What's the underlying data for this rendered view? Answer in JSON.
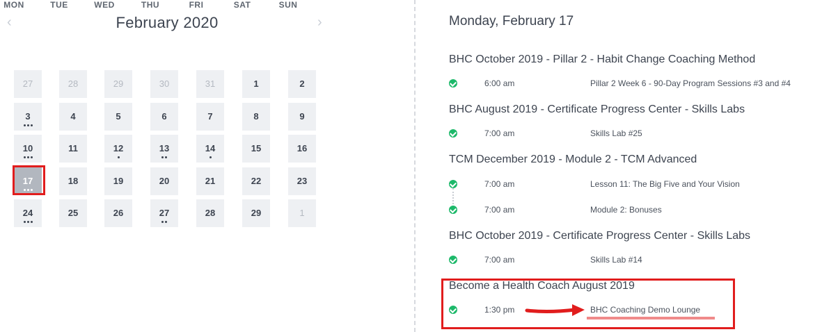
{
  "calendar": {
    "month_title": "February 2020",
    "prev_icon": "chevron-left-icon",
    "next_icon": "chevron-right-icon",
    "prev_glyph": "‹",
    "next_glyph": "›",
    "weekdays": [
      "MON",
      "TUE",
      "WED",
      "THU",
      "FRI",
      "SAT",
      "SUN"
    ],
    "weeks": [
      [
        {
          "d": "27",
          "other": true,
          "dots": 0
        },
        {
          "d": "28",
          "other": true,
          "dots": 0
        },
        {
          "d": "29",
          "other": true,
          "dots": 0
        },
        {
          "d": "30",
          "other": true,
          "dots": 0
        },
        {
          "d": "31",
          "other": true,
          "dots": 0
        },
        {
          "d": "1",
          "dots": 0
        },
        {
          "d": "2",
          "dots": 0
        }
      ],
      [
        {
          "d": "3",
          "dots": 3
        },
        {
          "d": "4",
          "dots": 0
        },
        {
          "d": "5",
          "dots": 0
        },
        {
          "d": "6",
          "dots": 0
        },
        {
          "d": "7",
          "dots": 0
        },
        {
          "d": "8",
          "dots": 0
        },
        {
          "d": "9",
          "dots": 0
        }
      ],
      [
        {
          "d": "10",
          "dots": 3
        },
        {
          "d": "11",
          "dots": 0
        },
        {
          "d": "12",
          "dots": 1
        },
        {
          "d": "13",
          "dots": 2
        },
        {
          "d": "14",
          "dots": 1
        },
        {
          "d": "15",
          "dots": 0
        },
        {
          "d": "16",
          "dots": 0
        }
      ],
      [
        {
          "d": "17",
          "dots": 3,
          "selected": true
        },
        {
          "d": "18",
          "dots": 0
        },
        {
          "d": "19",
          "dots": 0
        },
        {
          "d": "20",
          "dots": 0
        },
        {
          "d": "21",
          "dots": 0
        },
        {
          "d": "22",
          "dots": 0
        },
        {
          "d": "23",
          "dots": 0
        }
      ],
      [
        {
          "d": "24",
          "dots": 3
        },
        {
          "d": "25",
          "dots": 0
        },
        {
          "d": "26",
          "dots": 0
        },
        {
          "d": "27",
          "dots": 2
        },
        {
          "d": "28",
          "dots": 0
        },
        {
          "d": "29",
          "dots": 0
        },
        {
          "d": "1",
          "other": true,
          "dots": 0
        }
      ]
    ]
  },
  "schedule": {
    "day_title": "Monday, February 17",
    "groups": [
      {
        "course": "BHC October 2019 - Pillar 2 - Habit Change Coaching Method",
        "sessions": [
          {
            "time": "6:00 am",
            "name": "Pillar 2 Week 6 - 90-Day Program Sessions #3 and #4"
          }
        ]
      },
      {
        "course": "BHC August 2019 - Certificate Progress Center - Skills Labs",
        "sessions": [
          {
            "time": "7:00 am",
            "name": "Skills Lab #25"
          }
        ]
      },
      {
        "course": "TCM December 2019 - Module 2 - TCM Advanced",
        "sessions": [
          {
            "time": "7:00 am",
            "name": "Lesson 11: The Big Five and Your Vision"
          },
          {
            "time": "7:00 am",
            "name": "Module 2: Bonuses"
          }
        ]
      },
      {
        "course": "BHC October 2019 - Certificate Progress Center - Skills Labs",
        "sessions": [
          {
            "time": "7:00 am",
            "name": "Skills Lab #14"
          }
        ]
      },
      {
        "course": "Become a Health Coach August 2019",
        "sessions": [
          {
            "time": "1:30 pm",
            "name": "BHC Coaching Demo Lounge"
          }
        ]
      }
    ]
  },
  "colors": {
    "accent_green": "#1db96a",
    "highlight_red": "#e11d1d",
    "selected_day": "#b2b7bf",
    "day_bg": "#eef0f3"
  }
}
